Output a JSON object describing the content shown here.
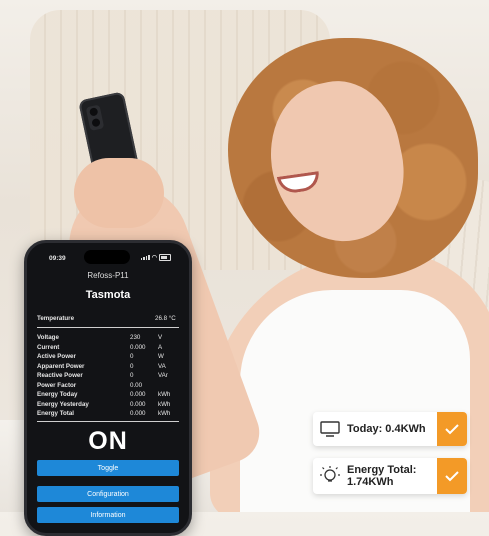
{
  "phone": {
    "status_time": "09:39",
    "device_name": "Refoss-P11",
    "app_title": "Tasmota",
    "temperature": {
      "label": "Temperature",
      "value": "26.8 °C"
    },
    "readings": [
      {
        "label": "Voltage",
        "value": "230",
        "unit": "V"
      },
      {
        "label": "Current",
        "value": "0.000",
        "unit": "A"
      },
      {
        "label": "Active Power",
        "value": "0",
        "unit": "W"
      },
      {
        "label": "Apparent Power",
        "value": "0",
        "unit": "VA"
      },
      {
        "label": "Reactive Power",
        "value": "0",
        "unit": "VAr"
      },
      {
        "label": "Power Factor",
        "value": "0.00",
        "unit": ""
      },
      {
        "label": "Energy Today",
        "value": "0.000",
        "unit": "kWh"
      },
      {
        "label": "Energy Yesterday",
        "value": "0.000",
        "unit": "kWh"
      },
      {
        "label": "Energy Total",
        "value": "0.000",
        "unit": "kWh"
      }
    ],
    "power_state": "ON",
    "buttons": {
      "toggle": "Toggle",
      "configuration": "Configuration",
      "information": "Information"
    }
  },
  "cards": {
    "today": {
      "text": "Today: 0.4KWh",
      "icon": "monitor-icon"
    },
    "total": {
      "line1": "Energy Total:",
      "line2": "1.74KWh",
      "icon": "lightbulb-icon"
    }
  },
  "colors": {
    "accent_button": "#1e88d8",
    "check_orange": "#f39a27",
    "phone_bg": "#121316"
  }
}
